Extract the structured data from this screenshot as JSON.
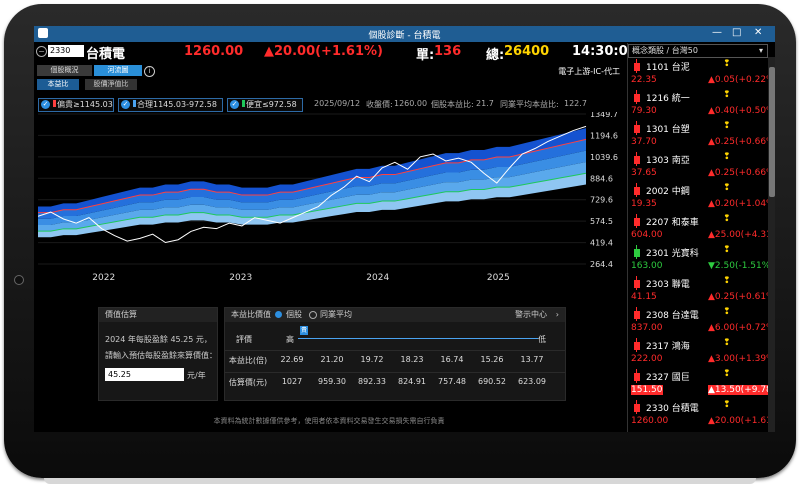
{
  "window": {
    "title": "個股診斷 - 台積電"
  },
  "stock": {
    "code": "2330",
    "name": "台積電",
    "price": "1260.00",
    "change": "▲20.00(+1.61%)",
    "vol_label": "單:",
    "vol": "136",
    "total_label": "總:",
    "total": "26400",
    "time": "14:30:00"
  },
  "tabs": [
    "個股概況",
    "河流圖"
  ],
  "subtabs": [
    "本益比",
    "股價淨值比"
  ],
  "industry": "電子上游-IC-代工",
  "legend": [
    {
      "label": "偏貴",
      "value": "1145.03",
      "color": "#ff4040"
    },
    {
      "label": "合理",
      "value": "1145.03-972.58",
      "color": "#4aa3f0"
    },
    {
      "label": "便宜",
      "value": "972.58",
      "color": "#1ec85a"
    }
  ],
  "meta": {
    "date": "2025/09/12",
    "close_label": "收盤價:",
    "close": "1260.00",
    "pe_label": "個股本益比:",
    "pe": "21.7",
    "peer_label": "同業平均本益比:",
    "peer": "122.7"
  },
  "chart_data": {
    "type": "area",
    "x_ticks": [
      "2022",
      "2023",
      "2024",
      "2025"
    ],
    "y_ticks": [
      "1349.7",
      "1194.6",
      "1039.6",
      "884.6",
      "729.6",
      "574.5",
      "419.4",
      "264.4"
    ],
    "ylim": [
      264.4,
      1349.7
    ],
    "x": [
      0,
      1,
      2,
      3,
      4,
      5,
      6,
      7,
      8,
      9,
      10,
      11,
      12,
      13,
      14,
      15,
      16,
      17,
      18,
      19,
      20,
      21,
      22,
      23,
      24,
      25,
      26,
      27,
      28,
      29,
      30,
      31,
      32,
      33,
      34,
      35,
      36,
      37,
      38,
      39,
      40,
      41,
      42,
      43
    ],
    "price": [
      610,
      640,
      590,
      560,
      600,
      520,
      470,
      430,
      450,
      480,
      420,
      440,
      500,
      530,
      520,
      560,
      540,
      600,
      580,
      560,
      600,
      640,
      680,
      760,
      820,
      900,
      860,
      960,
      1000,
      950,
      1040,
      1060,
      1010,
      1030,
      1000,
      920,
      850,
      960,
      1060,
      1100,
      1150,
      1190,
      1230,
      1260
    ],
    "bands": {
      "pe_multiples": [
        15.26,
        16.74,
        18.23,
        19.72,
        21.2,
        22.69
      ],
      "eps": [
        30,
        30,
        31,
        31,
        32,
        33,
        34,
        35,
        36,
        36,
        37,
        37,
        38,
        38,
        37,
        37,
        36,
        36,
        36,
        37,
        37,
        38,
        39,
        40,
        41,
        42,
        42,
        43,
        43,
        44,
        45,
        46,
        47,
        47,
        48,
        48,
        49,
        49,
        50,
        51,
        52,
        53,
        54,
        55
      ]
    }
  },
  "valuation": {
    "title": "價值估算",
    "eps_text": "2024 年每股盈餘 45.25 元，",
    "prompt": "請輸入預估每股盈餘來算價值：",
    "input_value": "45.25",
    "unit": "元/年"
  },
  "pe_table": {
    "header_label": "本益比價值",
    "radio1": "個股",
    "radio2": "同業平均",
    "alert": "警示中心",
    "rating_label": "評價",
    "high": "高",
    "low": "低",
    "marker": "貴",
    "row1_label": "本益比(倍)",
    "row1": [
      "22.69",
      "21.20",
      "19.72",
      "18.23",
      "16.74",
      "15.26",
      "13.77"
    ],
    "row2_label": "估算價(元)",
    "row2": [
      "1027",
      "959.30",
      "892.33",
      "824.91",
      "757.48",
      "690.52",
      "623.09"
    ]
  },
  "footer": "本資料為統計數據僅供參考，使用者依本資料交易發生交易損失需自行負責",
  "sidebar": {
    "header": "概念類股 / 台灣50",
    "items": [
      {
        "code": "1101 台泥",
        "price": "22.35",
        "change": "▲0.05(+0.22%)",
        "color": "#ff2b2b",
        "dir": "up"
      },
      {
        "code": "1216 統一",
        "price": "79.30",
        "change": "▲0.40(+0.50%)",
        "color": "#ff2b2b",
        "dir": "up"
      },
      {
        "code": "1301 台塑",
        "price": "37.70",
        "change": "▲0.25(+0.66%)",
        "color": "#ff2b2b",
        "dir": "up"
      },
      {
        "code": "1303 南亞",
        "price": "37.65",
        "change": "▲0.25(+0.66%)",
        "color": "#ff2b2b",
        "dir": "up"
      },
      {
        "code": "2002 中鋼",
        "price": "19.35",
        "change": "▲0.20(+1.04%)",
        "color": "#ff2b2b",
        "dir": "up"
      },
      {
        "code": "2207 和泰車",
        "price": "604.00",
        "change": "▲25.00(+4.31%)",
        "color": "#ff2b2b",
        "dir": "up"
      },
      {
        "code": "2301 光寶科",
        "price": "163.00",
        "change": "▼2.50(-1.51%)",
        "color": "#2ecc40",
        "dir": "down"
      },
      {
        "code": "2303 聯電",
        "price": "41.15",
        "change": "▲0.25(+0.61%)",
        "color": "#ff2b2b",
        "dir": "up"
      },
      {
        "code": "2308 台達電",
        "price": "837.00",
        "change": "▲6.00(+0.72%)",
        "color": "#ff2b2b",
        "dir": "up"
      },
      {
        "code": "2317 鴻海",
        "price": "222.00",
        "change": "▲3.00(+1.39%)",
        "color": "#ff2b2b",
        "dir": "up"
      },
      {
        "code": "2327 國巨",
        "price": "151.50",
        "change": "▲13.50(+9.78%)",
        "color": "#ff2b2b",
        "dir": "limit"
      },
      {
        "code": "2330 台積電",
        "price": "1260.00",
        "change": "▲20.00(+1.61%)",
        "color": "#ff2b2b",
        "dir": "up"
      }
    ]
  }
}
